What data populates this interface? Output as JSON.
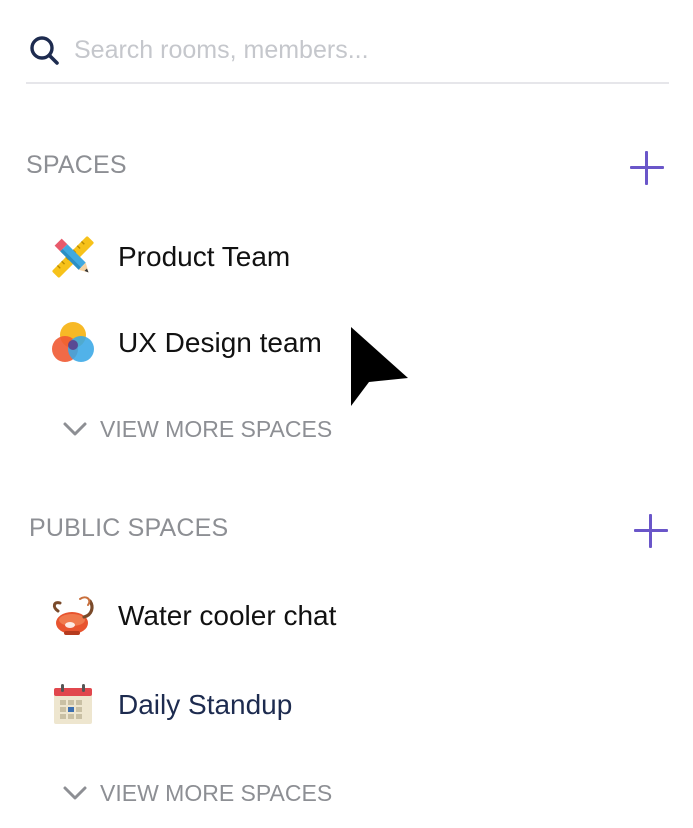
{
  "search": {
    "placeholder": "Search rooms, members...",
    "value": "",
    "icon": "search-icon"
  },
  "spaces": {
    "title": "SPACES",
    "add_icon": "plus-icon",
    "items": [
      {
        "label": "Product Team",
        "icon": "pencil-ruler-icon"
      },
      {
        "label": "UX Design team",
        "icon": "color-circles-icon"
      }
    ],
    "view_more": "VIEW MORE SPACES"
  },
  "public_spaces": {
    "title": "PUBLIC SPACES",
    "add_icon": "plus-icon",
    "items": [
      {
        "label": "Water cooler chat",
        "icon": "teapot-icon"
      },
      {
        "label": "Daily Standup",
        "icon": "calendar-icon"
      }
    ],
    "view_more": "VIEW MORE SPACES"
  },
  "colors": {
    "accent": "#6a56c9",
    "section_title": "#8d8f94",
    "placeholder": "#c5c7cc",
    "divider": "#e6e6ea",
    "daily_standup_text": "#1d2b4f"
  }
}
